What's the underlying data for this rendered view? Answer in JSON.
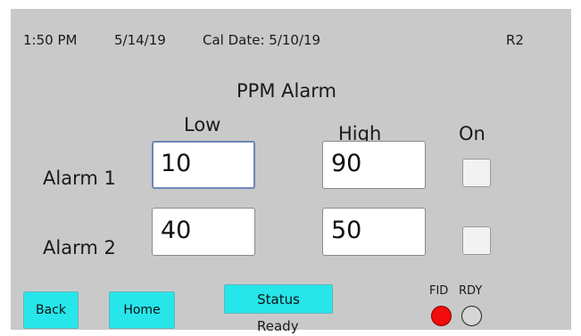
{
  "status_bar": {
    "time": "1:50 PM",
    "date": "5/14/19",
    "cal_date": "Cal Date: 5/10/19",
    "revision": "R2"
  },
  "title": "PPM Alarm",
  "headers": {
    "low": "Low",
    "high": "High",
    "on": "On"
  },
  "alarms": [
    {
      "label": "Alarm 1",
      "low": "10",
      "high": "90",
      "on": false
    },
    {
      "label": "Alarm 2",
      "low": "40",
      "high": "50",
      "on": false
    }
  ],
  "buttons": {
    "back": "Back",
    "home": "Home",
    "status": "Status"
  },
  "status_text": "Ready",
  "indicators": {
    "fid_label": "FID",
    "rdy_label": "RDY",
    "fid_color": "#f20c0c",
    "rdy_color": "#d6d6d6"
  },
  "colors": {
    "screen_bg": "#c9c9c9",
    "button_bg": "#27e6ea"
  }
}
